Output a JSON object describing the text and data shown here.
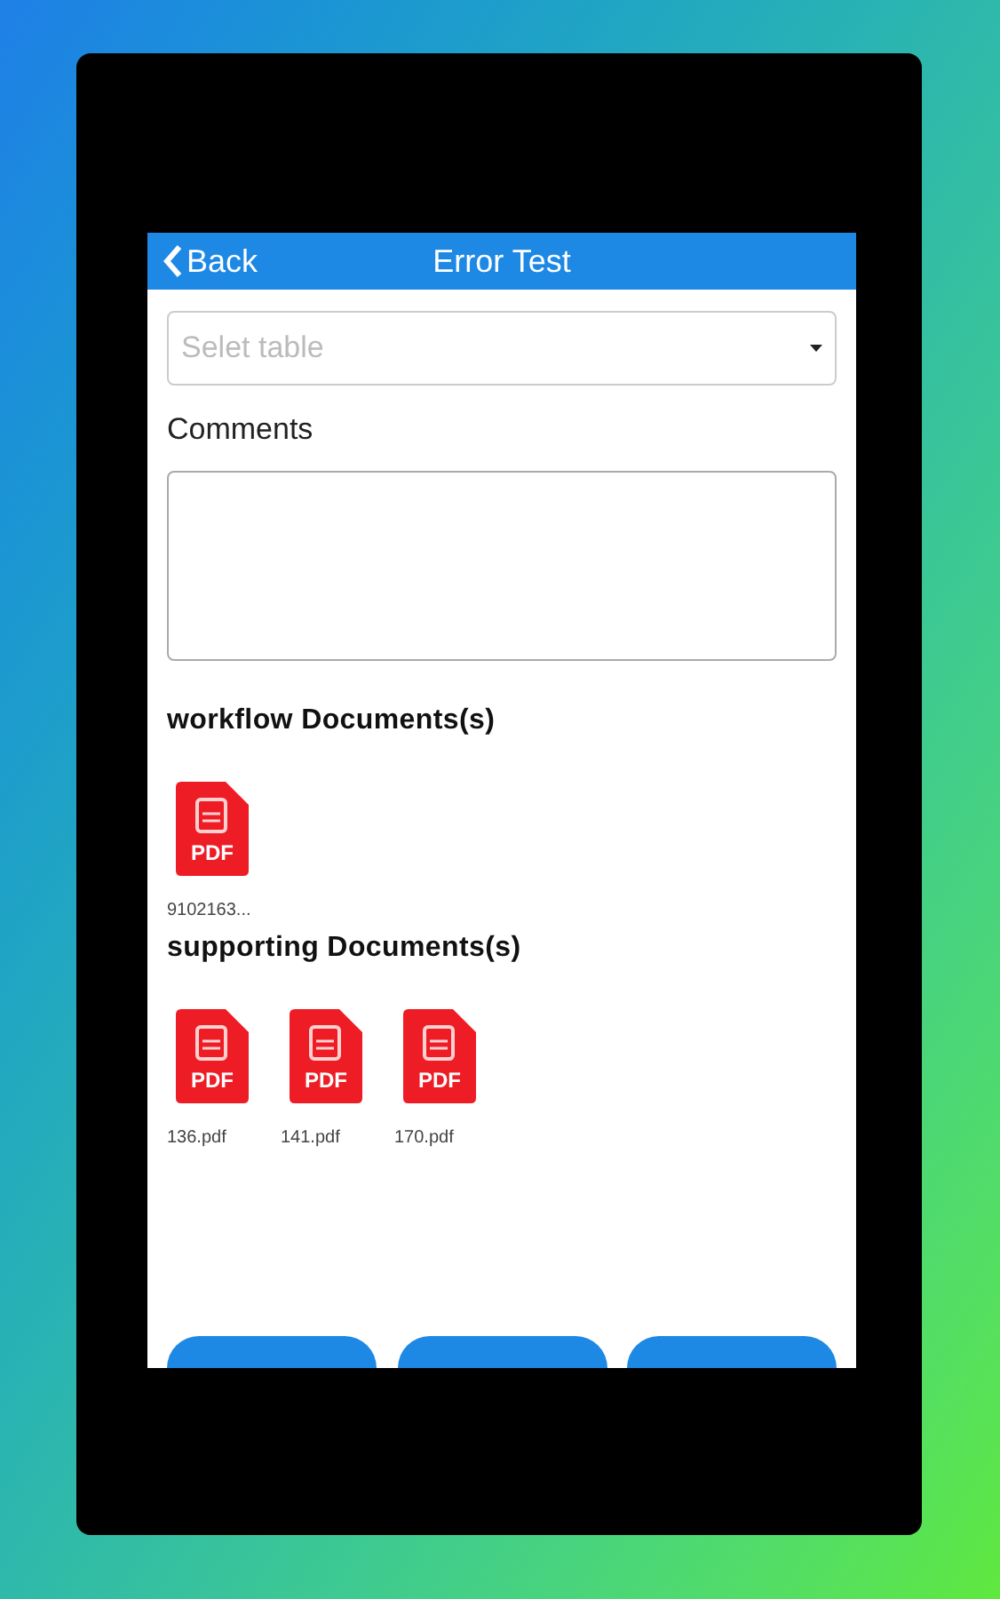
{
  "nav": {
    "back": "Back",
    "title": "Error Test"
  },
  "form": {
    "select_placeholder": "Selet table",
    "comments_label": "Comments"
  },
  "sections": [
    {
      "heading": "workflow Documents(s)",
      "files": [
        {
          "badge": "PDF",
          "name": "9102163..."
        }
      ]
    },
    {
      "heading": "supporting Documents(s)",
      "files": [
        {
          "badge": "PDF",
          "name": "136.pdf"
        },
        {
          "badge": "PDF",
          "name": "141.pdf"
        },
        {
          "badge": "PDF",
          "name": "170.pdf"
        }
      ]
    }
  ],
  "bottom_buttons": [
    {
      "kind": "button"
    },
    {
      "kind": "button"
    },
    {
      "kind": "button"
    }
  ]
}
